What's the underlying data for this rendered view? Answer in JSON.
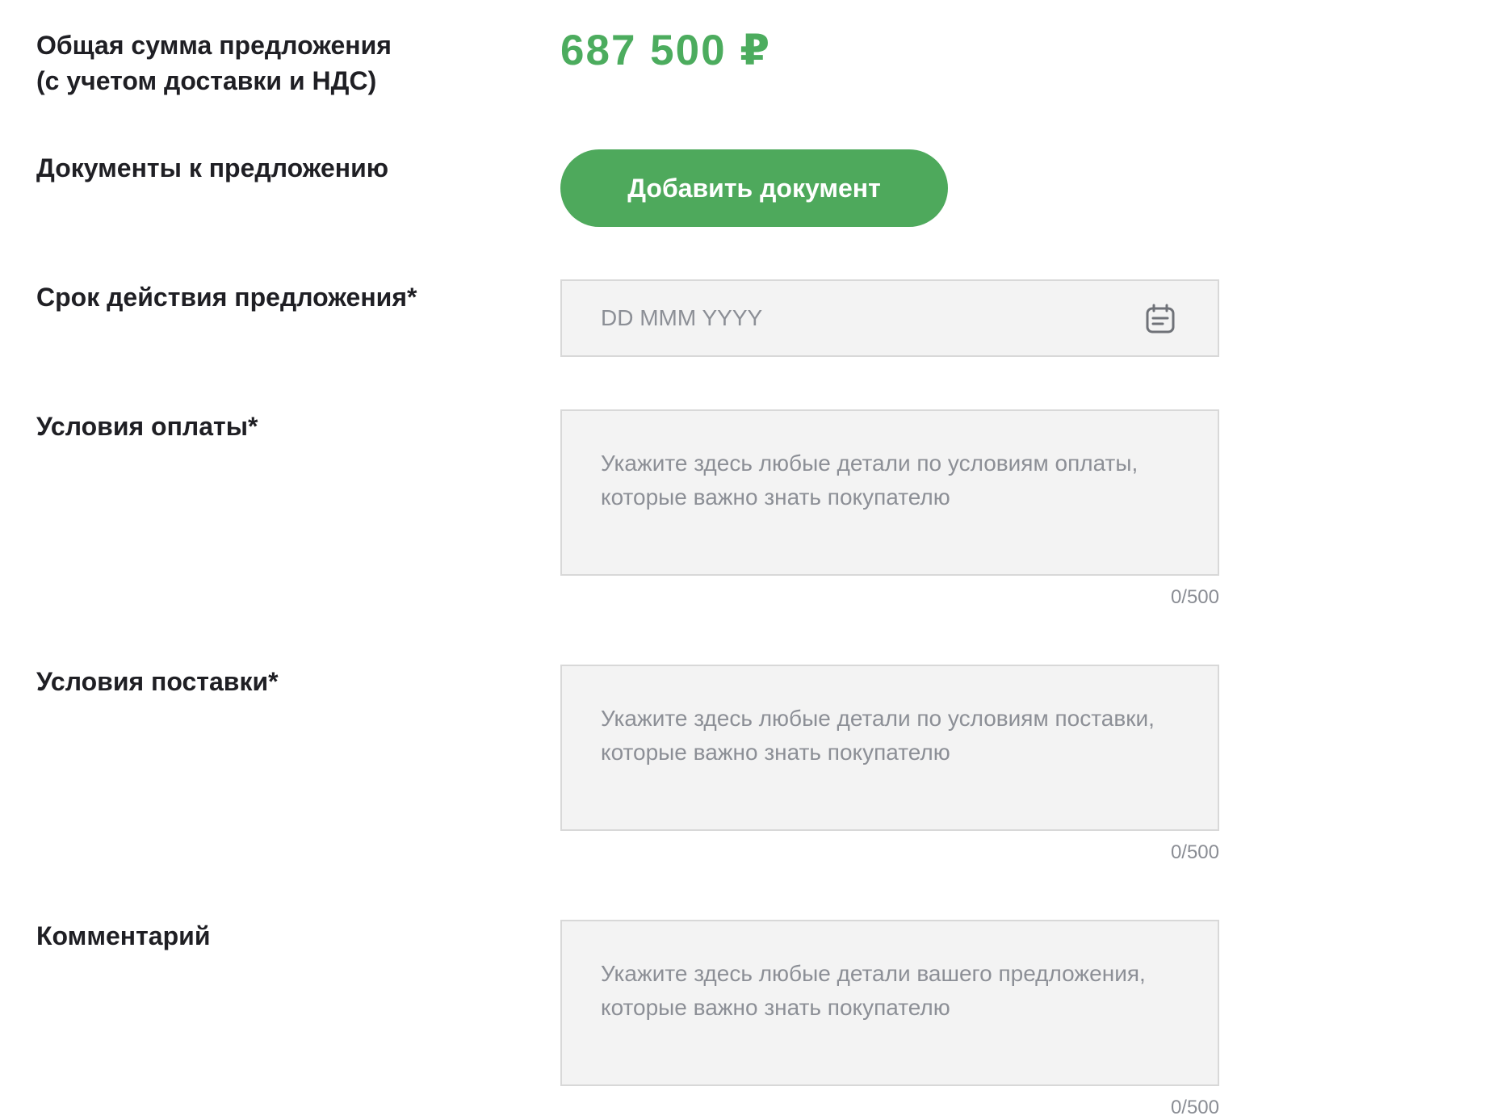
{
  "total": {
    "label_line1": "Общая сумма предложения",
    "label_line2": "(с учетом доставки и НДС)",
    "value": "687 500 ₽"
  },
  "documents": {
    "label": "Документы к предложению",
    "button_label": "Добавить документ"
  },
  "validity": {
    "label": "Срок действия предложения*",
    "placeholder": "DD MMM YYYY",
    "icon": "calendar-icon"
  },
  "payment_terms": {
    "label": "Условия оплаты*",
    "placeholder": "Укажите здесь любые детали по условиям оплаты, которые важно знать покупателю",
    "counter": "0/500"
  },
  "delivery_terms": {
    "label": "Условия поставки*",
    "placeholder": "Укажите здесь любые детали по условиям поставки, которые важно знать покупателю",
    "counter": "0/500"
  },
  "comment": {
    "label": "Комментарий",
    "placeholder": "Укажите здесь любые детали вашего предложения, которые важно знать покупателю",
    "counter": "0/500"
  },
  "colors": {
    "accent": "#4ea95c",
    "price": "#4cac5e",
    "field_bg": "#f3f3f3",
    "field_border": "#d8d8d8",
    "placeholder": "#8c8f96"
  }
}
